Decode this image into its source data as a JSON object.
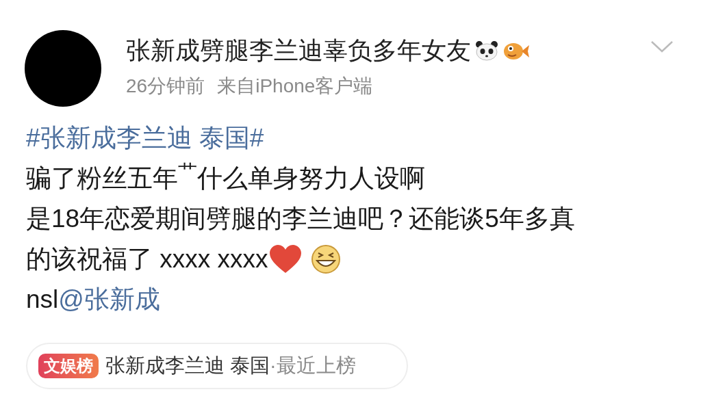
{
  "post": {
    "author": "张新成劈腿李兰迪辜负多年女友",
    "time": "26分钟前",
    "source": "来自iPhone客户端",
    "hashtag": "#张新成李兰迪 泰国#",
    "lines": [
      "骗了粉丝五年$^{艹}$什么单身努力人设啊",
      "是18年恋爱期间劈腿的李兰迪吧？还能谈5年多真",
      "的该祝福了 xxxx xxxx"
    ],
    "mention_prefix": "nsl",
    "mention": "@张新成"
  },
  "topic": {
    "badge": "文娱榜",
    "title": "张新成李兰迪 泰国",
    "suffix": "·最近上榜"
  }
}
